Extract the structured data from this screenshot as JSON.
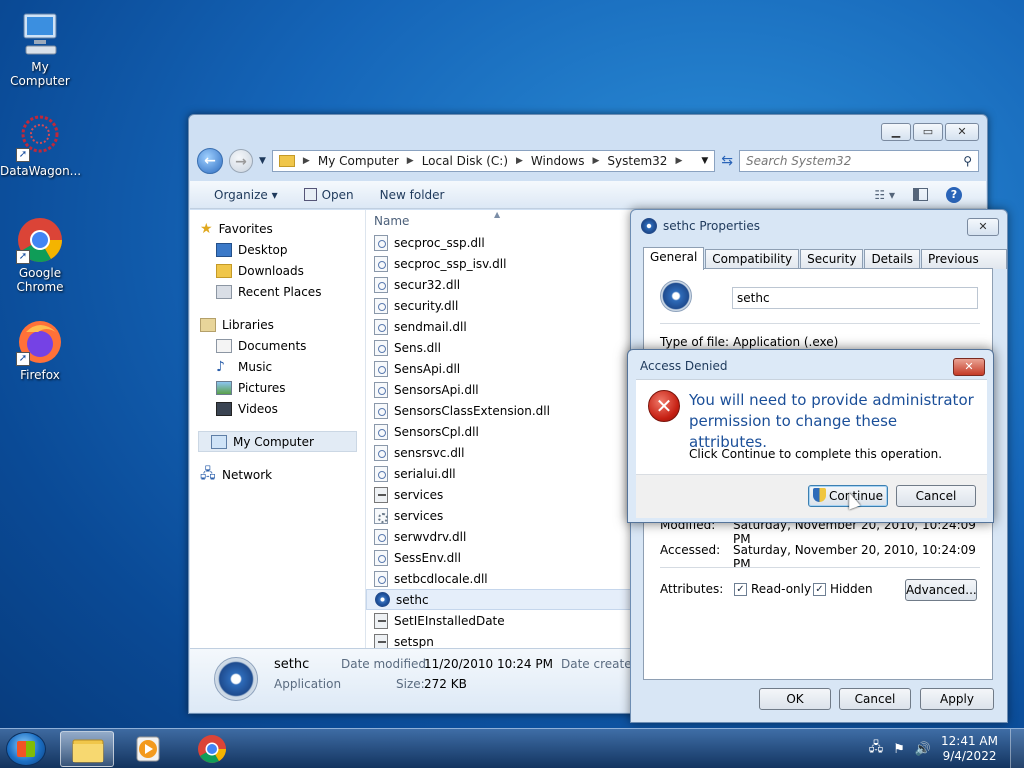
{
  "desktop": {
    "icons": [
      {
        "label": "My Computer"
      },
      {
        "label": "DataWagon..."
      },
      {
        "label": "Google Chrome"
      },
      {
        "label": "Firefox"
      }
    ]
  },
  "explorer": {
    "breadcrumb": [
      "My Computer",
      "Local Disk (C:)",
      "Windows",
      "System32"
    ],
    "search_placeholder": "Search System32",
    "toolbar": {
      "organize": "Organize ▾",
      "open": "Open",
      "new_folder": "New folder"
    },
    "nav": {
      "favorites": "Favorites",
      "favorites_items": [
        "Desktop",
        "Downloads",
        "Recent Places"
      ],
      "libraries": "Libraries",
      "libraries_items": [
        "Documents",
        "Music",
        "Pictures",
        "Videos"
      ],
      "my_computer": "My Computer",
      "network": "Network"
    },
    "column_name": "Name",
    "files": [
      {
        "name": "secproc_ssp.dll",
        "icon": "dll"
      },
      {
        "name": "secproc_ssp_isv.dll",
        "icon": "dll"
      },
      {
        "name": "secur32.dll",
        "icon": "dll"
      },
      {
        "name": "security.dll",
        "icon": "dll"
      },
      {
        "name": "sendmail.dll",
        "icon": "dll"
      },
      {
        "name": "Sens.dll",
        "icon": "dll"
      },
      {
        "name": "SensApi.dll",
        "icon": "dll"
      },
      {
        "name": "SensorsApi.dll",
        "icon": "dll"
      },
      {
        "name": "SensorsClassExtension.dll",
        "icon": "dll"
      },
      {
        "name": "SensorsCpl.dll",
        "icon": "dll"
      },
      {
        "name": "sensrsvc.dll",
        "icon": "dll"
      },
      {
        "name": "serialui.dll",
        "icon": "dll"
      },
      {
        "name": "services",
        "icon": "exe"
      },
      {
        "name": "services",
        "icon": "gear"
      },
      {
        "name": "serwvdrv.dll",
        "icon": "dll"
      },
      {
        "name": "SessEnv.dll",
        "icon": "dll"
      },
      {
        "name": "setbcdlocale.dll",
        "icon": "dll"
      },
      {
        "name": "sethc",
        "icon": "blue"
      },
      {
        "name": "SetIEInstalledDate",
        "icon": "exe"
      },
      {
        "name": "setspn",
        "icon": "exe"
      }
    ],
    "details": {
      "name": "sethc",
      "type": "Application",
      "date_modified_label": "Date modified:",
      "date_modified": "11/20/2010 10:24 PM",
      "size_label": "Size:",
      "size": "272 KB",
      "date_created_label": "Date created:"
    }
  },
  "properties": {
    "title": "sethc Properties",
    "tabs": [
      "General",
      "Compatibility",
      "Security",
      "Details",
      "Previous Versions"
    ],
    "name_value": "sethc",
    "type_label": "Type of file:",
    "type_value": "Application (.exe)",
    "modified_label": "Modified:",
    "modified_value": "Saturday, November 20, 2010, 10:24:09 PM",
    "accessed_label": "Accessed:",
    "accessed_value": "Saturday, November 20, 2010, 10:24:09 PM",
    "attributes_label": "Attributes:",
    "readonly_label": "Read-only",
    "hidden_label": "Hidden",
    "advanced_label": "Advanced...",
    "ok_label": "OK",
    "cancel_label": "Cancel",
    "apply_label": "Apply"
  },
  "access_denied": {
    "title": "Access Denied",
    "message": "You will need to provide administrator permission to change these attributes.",
    "submessage": "Click Continue to complete this operation.",
    "continue_label": "Continue",
    "cancel_label": "Cancel"
  },
  "taskbar": {
    "time": "12:41 AM",
    "date": "9/4/2022"
  }
}
